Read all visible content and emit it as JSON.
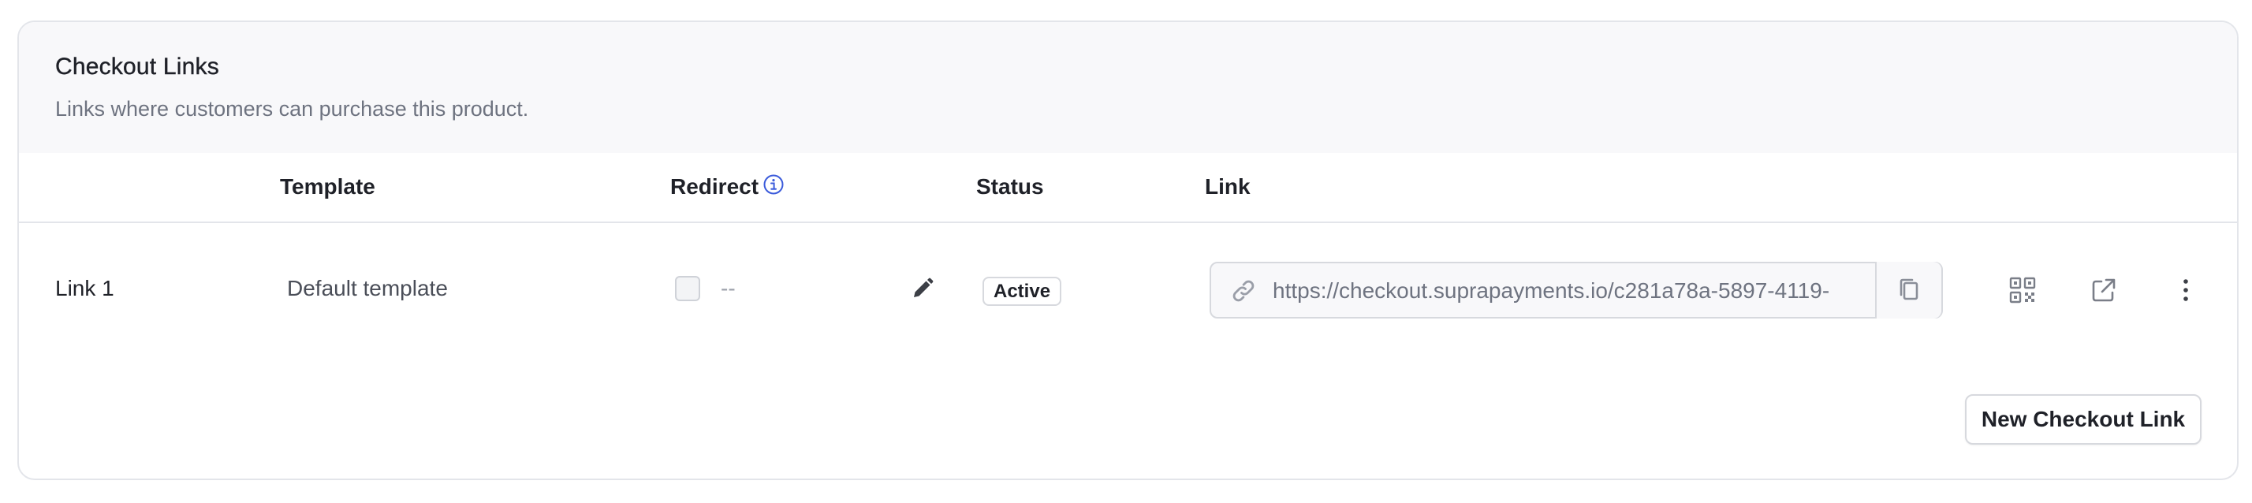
{
  "card": {
    "title": "Checkout Links",
    "description": "Links where customers can purchase this product."
  },
  "table": {
    "headers": {
      "template": "Template",
      "redirect": "Redirect",
      "status": "Status",
      "link": "Link"
    },
    "rows": [
      {
        "name": "Link 1",
        "template": "Default template",
        "redirect_enabled": false,
        "redirect_value": "--",
        "status": "Active",
        "url": "https://checkout.suprapayments.io/c281a78a-5897-4119-"
      }
    ]
  },
  "icons": {
    "redirect_info": "info-icon",
    "edit": "pencil-icon",
    "link": "link-chain-icon",
    "copy": "copy-icon",
    "qr": "qr-code-icon",
    "open": "external-link-icon",
    "more": "more-vertical-icon"
  },
  "actions": {
    "new_link_label": "New Checkout Link"
  },
  "colors": {
    "header_bg": "#f8f8fa",
    "border": "#e3e5ea",
    "muted_text": "#6e7380",
    "info_blue": "#3b5bdb"
  }
}
